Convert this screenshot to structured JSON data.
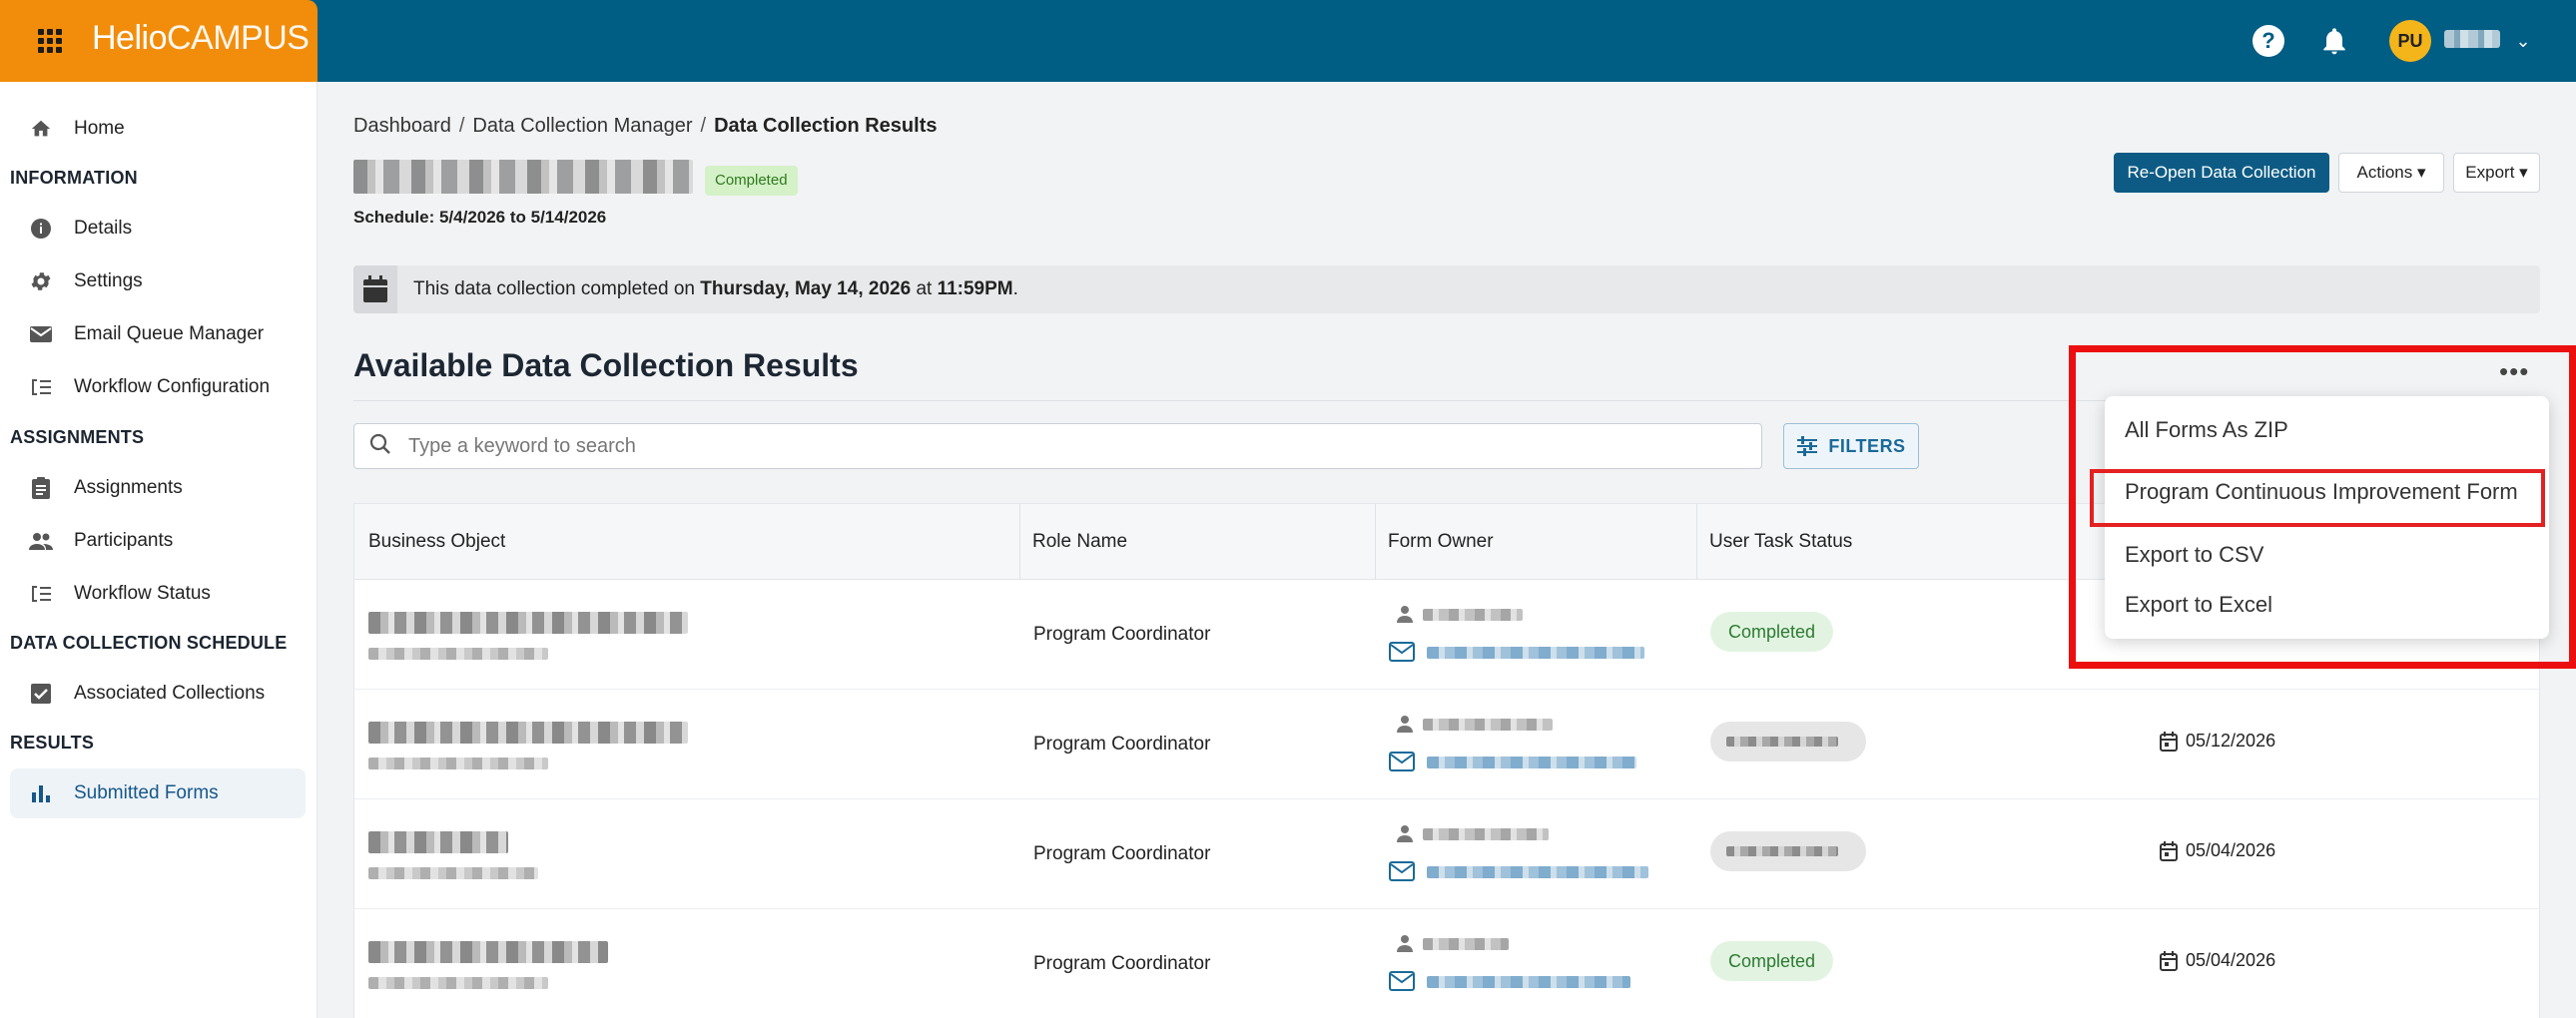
{
  "app": {
    "brand_bold": "Helio",
    "brand_light": "CAMPUS",
    "avatar_initials": "PU",
    "accent_color": "#005d84",
    "brand_color": "#f28d0b"
  },
  "sidebar": {
    "home": "Home",
    "sections": {
      "information": "INFORMATION",
      "assignments": "ASSIGNMENTS",
      "schedule": "DATA COLLECTION SCHEDULE",
      "results": "RESULTS"
    },
    "items": [
      {
        "label": "Details",
        "icon": "info-icon"
      },
      {
        "label": "Settings",
        "icon": "gear-icon"
      },
      {
        "label": "Email Queue Manager",
        "icon": "mail-icon"
      },
      {
        "label": "Workflow Configuration",
        "icon": "workflow-icon"
      },
      {
        "label": "Assignments",
        "icon": "clipboard-icon"
      },
      {
        "label": "Participants",
        "icon": "people-icon"
      },
      {
        "label": "Workflow Status",
        "icon": "workflow-icon"
      },
      {
        "label": "Associated Collections",
        "icon": "checkbox-icon"
      },
      {
        "label": "Submitted Forms",
        "icon": "bar-chart-icon",
        "active": true
      }
    ]
  },
  "breadcrumb": {
    "dashboard": "Dashboard",
    "manager": "Data Collection Manager",
    "current": "Data Collection Results",
    "separator": "/"
  },
  "header": {
    "status": "Completed",
    "schedule": "Schedule: 5/4/2026 to 5/14/2026",
    "reopen_label": "Re-Open Data Collection",
    "actions_label": "Actions ▾",
    "export_label": "Export ▾"
  },
  "notice": {
    "prefix": "This data collection completed on",
    "date": "Thursday, May 14, 2026",
    "mid": "at",
    "time": "11:59PM",
    "suffix": "."
  },
  "results": {
    "title": "Available Data Collection Results",
    "search_placeholder": "Type a keyword to search",
    "filters_label": "FILTERS",
    "more_label": "•••"
  },
  "table": {
    "columns": [
      "Business Object",
      "Role Name",
      "Form Owner",
      "User Task Status"
    ],
    "rows": [
      {
        "role": "Program Coordinator",
        "status": "Completed",
        "date": ""
      },
      {
        "role": "Program Coordinator",
        "status": "",
        "date": "05/12/2026"
      },
      {
        "role": "Program Coordinator",
        "status": "",
        "date": "05/04/2026"
      },
      {
        "role": "Program Coordinator",
        "status": "Completed",
        "date": "05/04/2026"
      }
    ]
  },
  "dropdown": {
    "items": [
      "All Forms As ZIP",
      "Program Continuous Improvement Form",
      "Export to CSV",
      "Export to Excel"
    ],
    "highlight_color": "#ec0f0f"
  }
}
